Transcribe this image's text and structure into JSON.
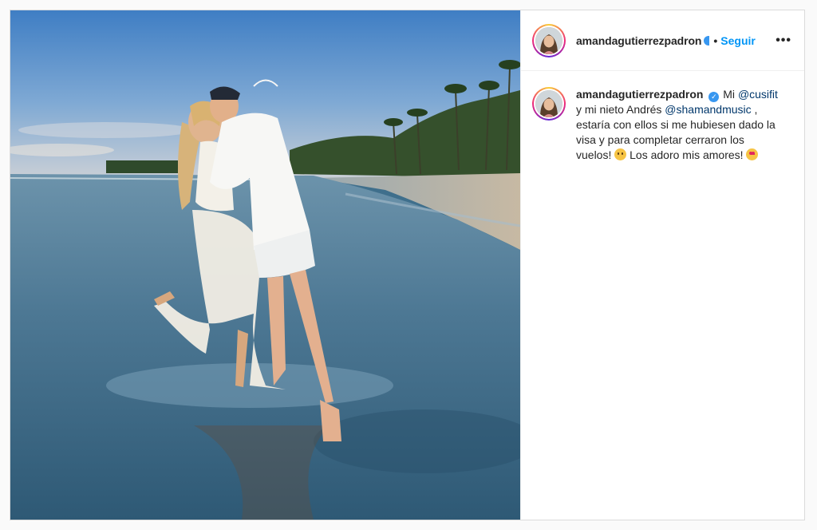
{
  "post": {
    "image_alt": "Couple hugging on a beach at sunset",
    "header": {
      "username": "amandagutierrezpadron",
      "separator": "•",
      "follow_label": "Seguir",
      "more_label": "•••"
    },
    "caption": {
      "username": "amandagutierrezpadron",
      "parts": {
        "p1": "Mi",
        "mention1": "@cusifit",
        "p2": "y mi nieto Andrés",
        "mention2": "@shamandmusic",
        "p3": ", estaría con ellos si me hubiesen dado la visa y para completar cerraron los vuelos!",
        "p4": "Los adoro mis amores!"
      }
    },
    "colors": {
      "link": "#00376b",
      "follow": "#0095f6",
      "verified": "#3897f0"
    }
  }
}
